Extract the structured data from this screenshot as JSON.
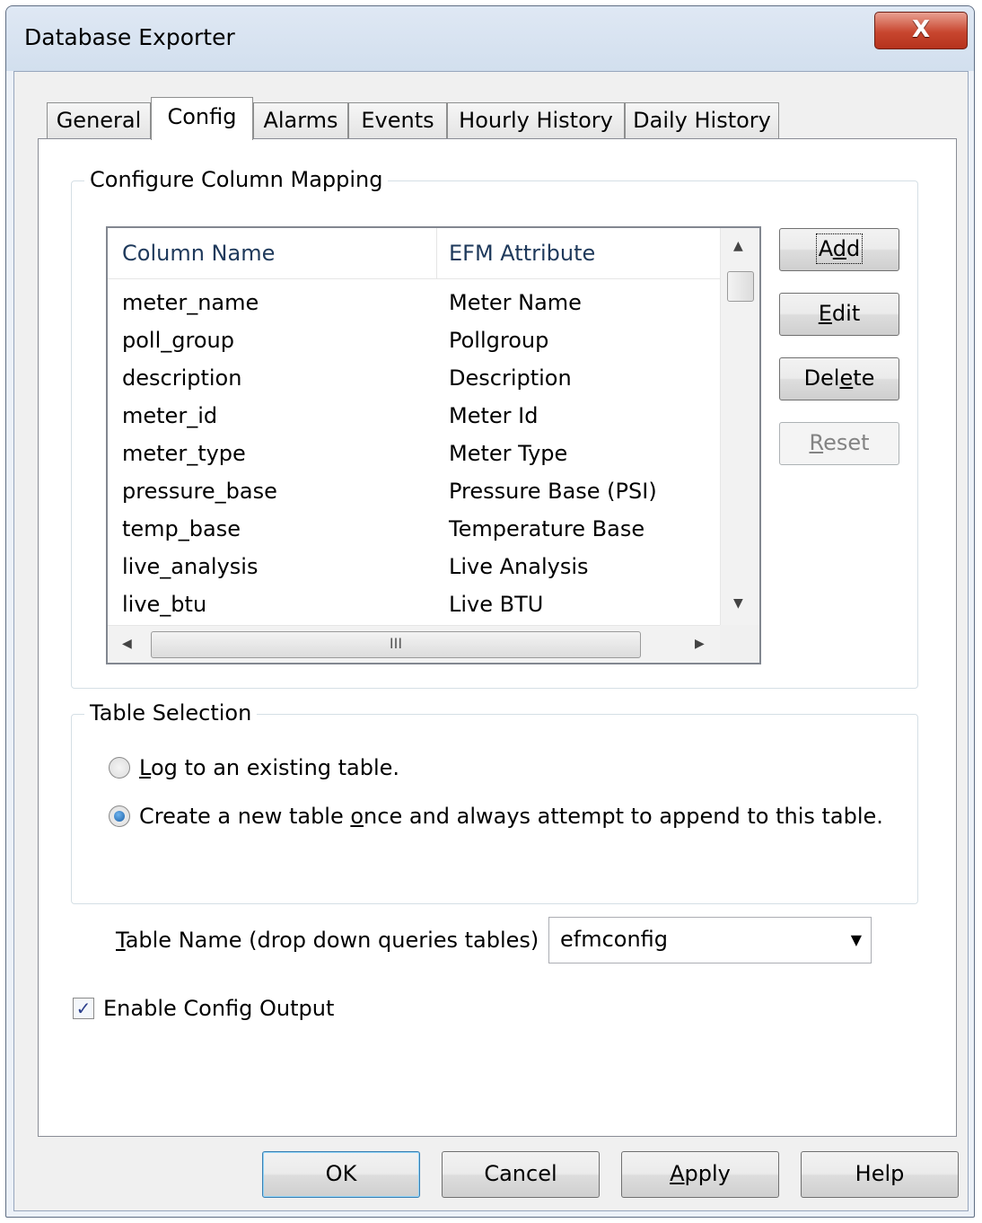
{
  "window": {
    "title": "Database Exporter",
    "close_glyph": "X"
  },
  "tabs": [
    {
      "label": "General"
    },
    {
      "label": "Config"
    },
    {
      "label": "Alarms"
    },
    {
      "label": "Events"
    },
    {
      "label": "Hourly History"
    },
    {
      "label": "Daily History"
    }
  ],
  "active_tab": "Config",
  "mapping": {
    "group_label": "Configure Column Mapping",
    "columns": [
      "Column Name",
      "EFM Attribute"
    ],
    "rows": [
      {
        "column": "meter_name",
        "attribute": "Meter Name"
      },
      {
        "column": "poll_group",
        "attribute": "Pollgroup"
      },
      {
        "column": "description",
        "attribute": "Description"
      },
      {
        "column": "meter_id",
        "attribute": "Meter Id"
      },
      {
        "column": "meter_type",
        "attribute": "Meter Type"
      },
      {
        "column": "pressure_base",
        "attribute": "Pressure Base (PSI)"
      },
      {
        "column": "temp_base",
        "attribute": "Temperature Base"
      },
      {
        "column": "live_analysis",
        "attribute": "Live Analysis"
      },
      {
        "column": "live_btu",
        "attribute": "Live BTU"
      }
    ],
    "hscroll_grip": "III",
    "buttons": {
      "add": {
        "pre": "A",
        "key": "d",
        "post": "d"
      },
      "edit": {
        "pre": "",
        "key": "E",
        "post": "dit"
      },
      "delete": {
        "pre": "Del",
        "key": "e",
        "post": "te"
      },
      "reset": {
        "pre": "",
        "key": "R",
        "post": "eset",
        "disabled": true
      }
    }
  },
  "table_selection": {
    "group_label": "Table Selection",
    "option_existing": {
      "pre": "",
      "key": "L",
      "post": "og to an existing table.",
      "checked": false
    },
    "option_new": {
      "pre": "Create a new table ",
      "key": "o",
      "post": "nce and always attempt to append to this table.",
      "checked": true
    },
    "table_name_label": {
      "pre": "",
      "key": "T",
      "post": "able Name (drop down queries tables)"
    },
    "table_name_value": "efmconfig"
  },
  "enable_output": {
    "label": "Enable Config Output",
    "checked": true,
    "check_glyph": "✓"
  },
  "footer": {
    "ok": "OK",
    "cancel": "Cancel",
    "apply": {
      "pre": "",
      "key": "A",
      "post": "pply"
    },
    "help": "Help"
  },
  "colors": {
    "accent": "#3c7fb1",
    "close_red": "#c8462f"
  }
}
